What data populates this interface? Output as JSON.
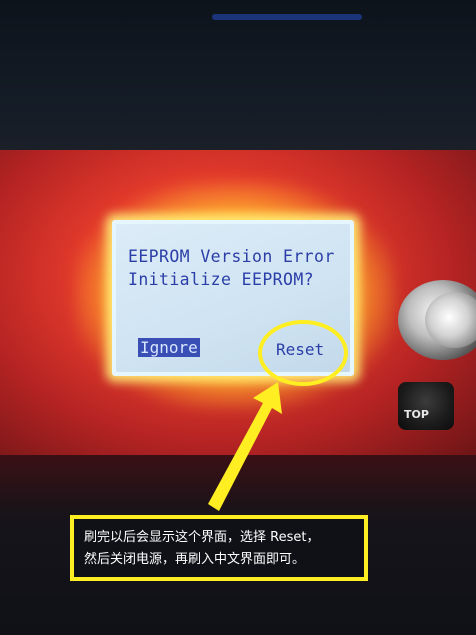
{
  "lcd": {
    "line1": "EEPROM Version Error",
    "line2": "Initialize EEPROM?",
    "ignore_label": "Ignore",
    "reset_label": "Reset"
  },
  "device": {
    "stop_label": "TOP"
  },
  "annotation": {
    "line1": "刷完以后会显示这个界面，选择 Reset，",
    "line2": "然后关闭电源，再刷入中文界面即可。",
    "highlight_color": "#ffee22"
  },
  "colors": {
    "lcd_text": "#2b3ea8",
    "lcd_background": "#d3e6f4",
    "panel": "#e53b2c",
    "annotation_border": "#ffee22"
  }
}
